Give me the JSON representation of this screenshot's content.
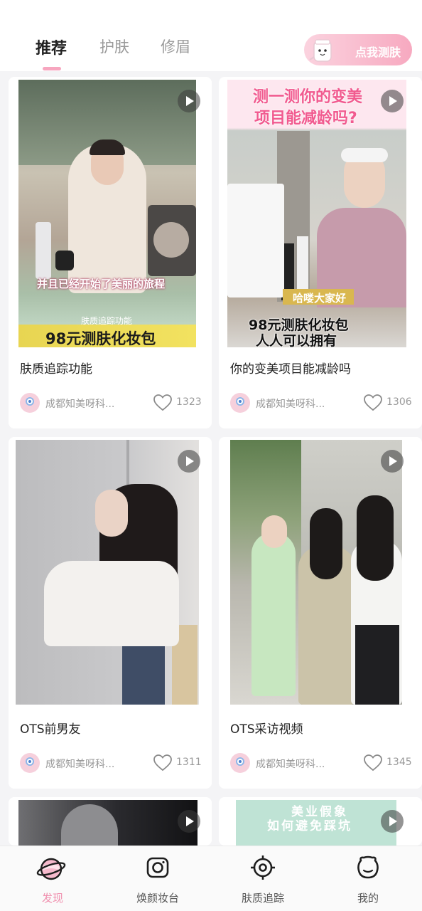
{
  "tabs": [
    {
      "label": "推荐",
      "active": true
    },
    {
      "label": "护肤",
      "active": false
    },
    {
      "label": "修眉",
      "active": false
    }
  ],
  "test_button": {
    "label": "点我测肤"
  },
  "cards": [
    {
      "title": "肤质追踪功能",
      "author": "成都知美呀科...",
      "likes": "1323",
      "overlay": [
        "并且已经开始了美丽的旅程",
        "肤质追踪功能",
        "98元测肤化妆包"
      ]
    },
    {
      "title": "你的变美项目能减龄吗",
      "author": "成都知美呀科...",
      "likes": "1306",
      "overlay": [
        "测一测你的变美",
        "项目能减龄吗?",
        "哈喽大家好",
        "98元测肤化妆包",
        "人人可以拥有"
      ]
    },
    {
      "title": "OTS前男友",
      "author": "成都知美呀科...",
      "likes": "1311",
      "overlay": []
    },
    {
      "title": "OTS采访视频",
      "author": "成都知美呀科...",
      "likes": "1345",
      "overlay": []
    },
    {
      "overlay": []
    },
    {
      "overlay": [
        "美业假象",
        "如何避免踩坑"
      ]
    }
  ],
  "bottom_nav": [
    {
      "label": "发现",
      "icon": "planet-icon",
      "active": true
    },
    {
      "label": "焕颜妆台",
      "icon": "camera-icon",
      "active": false
    },
    {
      "label": "肤质追踪",
      "icon": "target-icon",
      "active": false
    },
    {
      "label": "我的",
      "icon": "profile-icon",
      "active": false
    }
  ],
  "colors": {
    "accent": "#f08fae",
    "background": "#f4f4f6"
  }
}
